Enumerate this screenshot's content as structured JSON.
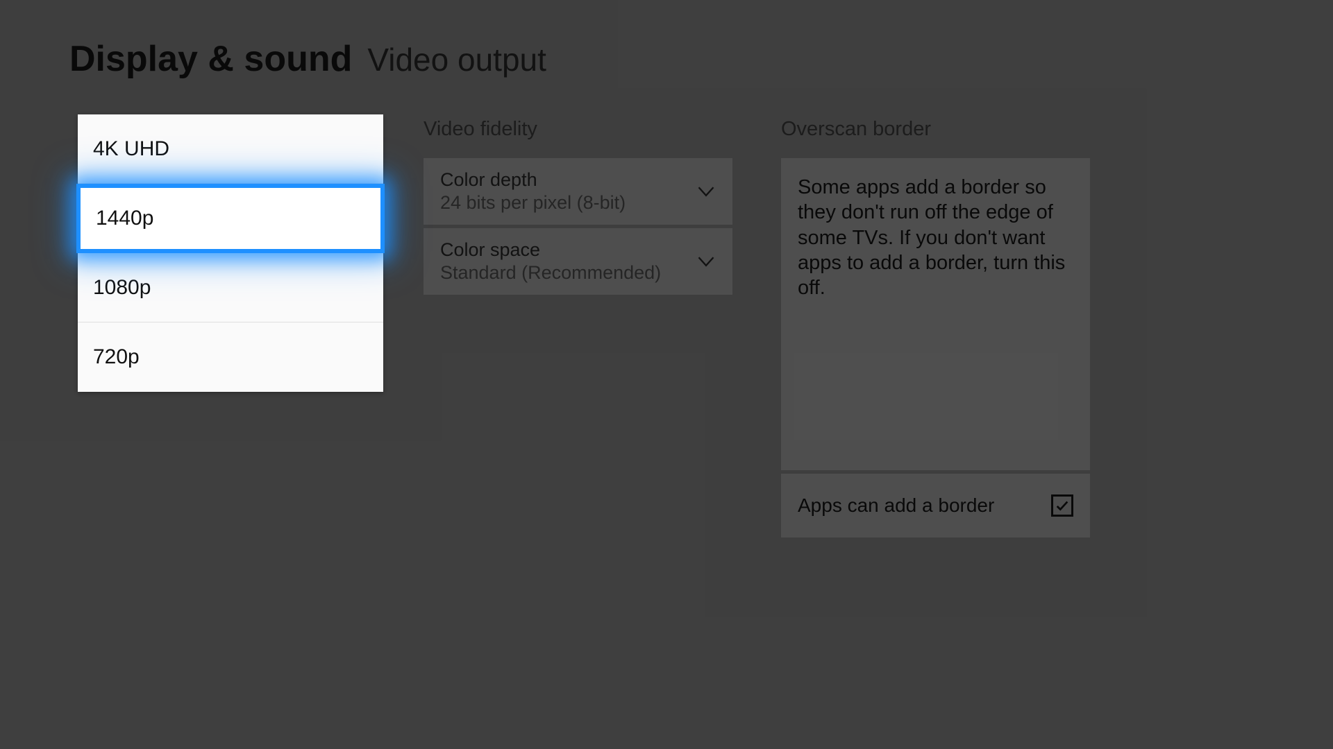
{
  "header": {
    "title": "Display & sound",
    "subtitle": "Video output"
  },
  "resolution_popup": {
    "options": [
      "4K UHD",
      "1440p",
      "1080p",
      "720p"
    ],
    "selected_index": 1
  },
  "video_fidelity": {
    "heading": "Video fidelity",
    "color_depth_label": "Color depth",
    "color_depth_value": "24 bits per pixel (8-bit)",
    "color_space_label": "Color space",
    "color_space_value": "Standard (Recommended)"
  },
  "overscan": {
    "heading": "Overscan border",
    "description": "Some apps add a border so they don't run off the edge of some TVs. If you don't want apps to add a border, turn this off.",
    "checkbox_label": "Apps can add a border",
    "checkbox_checked": true
  }
}
